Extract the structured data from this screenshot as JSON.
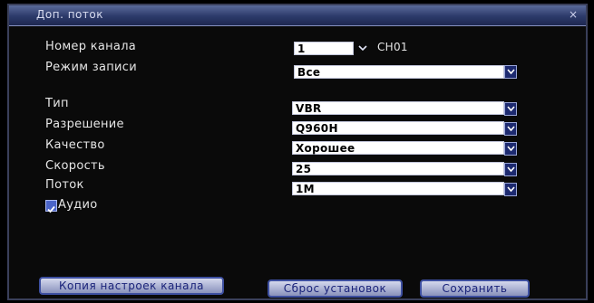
{
  "window": {
    "title": "Доп. поток",
    "close_glyph": "×"
  },
  "fields": {
    "channel_label": "Номер канала",
    "channel_value": "1",
    "channel_name": "CH01",
    "record_mode_label": "Режим записи",
    "record_mode_value": "Все",
    "type_label": "Тип",
    "type_value": "VBR",
    "resolution_label": "Разрешение",
    "resolution_value": "Q960H",
    "quality_label": "Качество",
    "quality_value": "Хорошее",
    "speed_label": "Скорость",
    "speed_value": "25",
    "bitrate_label": "Поток",
    "bitrate_value": "1M",
    "audio_label": "Аудио",
    "audio_checked": true
  },
  "buttons": {
    "copy": "Копия настроек канала",
    "reset": "Сброс установок",
    "save": "Сохранить"
  },
  "colors": {
    "titlebar": "#2c3a6a",
    "dropdown_arrow": "#1d2a70",
    "button_text": "#1a237a"
  }
}
